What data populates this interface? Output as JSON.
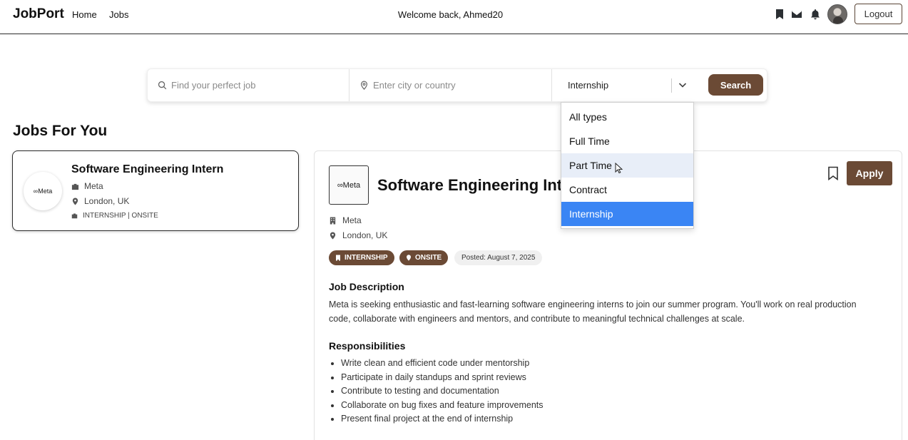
{
  "navbar": {
    "brand": "JobPort",
    "links": [
      "Home",
      "Jobs"
    ],
    "welcome": "Welcome back, Ahmed20",
    "logout_label": "Logout"
  },
  "search": {
    "job_placeholder": "Find your perfect job",
    "location_placeholder": "Enter city or country",
    "selected_type": "Internship",
    "button_label": "Search",
    "dropdown_options": [
      "All types",
      "Full Time",
      "Part Time",
      "Contract",
      "Internship"
    ],
    "hovered_option": "Part Time",
    "selected_option": "Internship"
  },
  "section_title": "Jobs For You",
  "job_card": {
    "logo_text": "∞Meta",
    "title": "Software Engineering Intern",
    "company": "Meta",
    "location": "London, UK",
    "type_line": "INTERNSHIP | ONSITE"
  },
  "detail": {
    "logo_text": "∞Meta",
    "title": "Software Engineering Intern",
    "apply_label": "Apply",
    "company": "Meta",
    "location": "London, UK",
    "badge_type": "INTERNSHIP",
    "badge_mode": "ONSITE",
    "posted": "Posted: August 7, 2025",
    "description_heading": "Job Description",
    "description": "Meta is seeking enthusiastic and fast-learning software engineering interns to join our summer program. You'll work on real production code, collaborate with engineers and mentors, and contribute to meaningful technical challenges at scale.",
    "responsibilities_heading": "Responsibilities",
    "responsibilities": [
      "Write clean and efficient code under mentorship",
      "Participate in daily standups and sprint reviews",
      "Contribute to testing and documentation",
      "Collaborate on bug fixes and feature improvements",
      "Present final project at the end of internship"
    ]
  },
  "colors": {
    "brand_brown": "#6b4a35",
    "selected_blue": "#3a85f4",
    "hover_blue": "#e8eef8"
  }
}
